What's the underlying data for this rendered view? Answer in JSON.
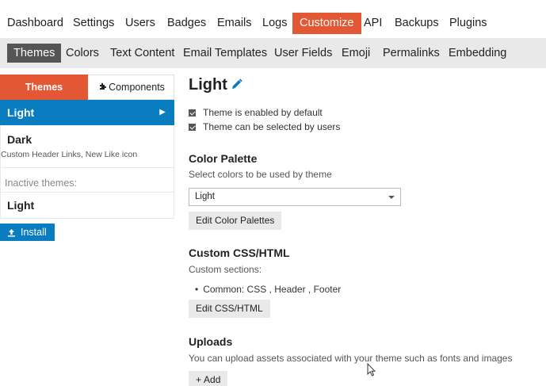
{
  "topnav": [
    {
      "label": "Dashboard",
      "active": false
    },
    {
      "label": "Settings",
      "active": false
    },
    {
      "label": "Users",
      "active": false
    },
    {
      "label": "Badges",
      "active": false
    },
    {
      "label": "Emails",
      "active": false
    },
    {
      "label": "Logs",
      "active": false
    },
    {
      "label": "Customize",
      "active": true
    },
    {
      "label": "API",
      "active": false
    },
    {
      "label": "Backups",
      "active": false
    },
    {
      "label": "Plugins",
      "active": false
    }
  ],
  "subnav": [
    {
      "label": "Themes",
      "active": true
    },
    {
      "label": "Colors",
      "active": false
    },
    {
      "label": "Text Content",
      "active": false
    },
    {
      "label": "Email Templates",
      "active": false
    },
    {
      "label": "User Fields",
      "active": false
    },
    {
      "label": "Emoji",
      "active": false
    },
    {
      "label": "Permalinks",
      "active": false
    },
    {
      "label": "Embedding",
      "active": false
    }
  ],
  "sidebar": {
    "tabs": {
      "themes": "Themes",
      "components": "Components"
    },
    "themes": [
      {
        "name": "Light",
        "selected": true
      },
      {
        "name": "Dark",
        "description": "Custom Header Links, New Like icon"
      }
    ],
    "inactive_label": "Inactive themes:",
    "inactive_themes": [
      {
        "name": "Light"
      }
    ],
    "install_label": "Install"
  },
  "main": {
    "title": "Light",
    "checkboxes": [
      {
        "label": "Theme is enabled by default",
        "checked": true
      },
      {
        "label": "Theme can be selected by users",
        "checked": true
      }
    ],
    "color_palette": {
      "heading": "Color Palette",
      "description": "Select colors to be used by theme",
      "selected": "Light",
      "edit_button": "Edit Color Palettes"
    },
    "custom_css": {
      "heading": "Custom CSS/HTML",
      "description": "Custom sections:",
      "item": "Common: CSS , Header , Footer",
      "edit_button": "Edit CSS/HTML"
    },
    "uploads": {
      "heading": "Uploads",
      "description": "You can upload assets associated with your theme such as fonts and images",
      "add_button": "Add"
    }
  },
  "colors": {
    "accent": "#e45735",
    "selected": "#0a7dc1",
    "subnav_bg": "#e9e9e9",
    "subnav_active": "#555555"
  },
  "icons": {
    "edit": "pencil-icon",
    "install": "upload-icon",
    "components": "puzzle-icon",
    "add": "plus-icon"
  }
}
